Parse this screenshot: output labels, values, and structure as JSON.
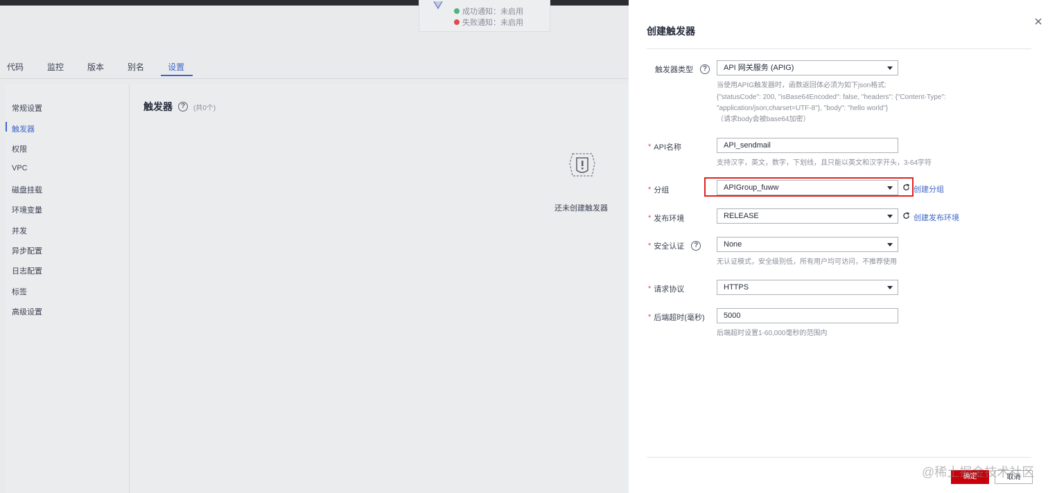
{
  "notifications": {
    "success": "成功通知：未启用",
    "failure": "失败通知：未启用"
  },
  "tabs": [
    "代码",
    "监控",
    "版本",
    "别名",
    "设置"
  ],
  "active_tab": "设置",
  "sidebar": {
    "items": [
      "常规设置",
      "触发器",
      "权限",
      "VPC",
      "磁盘挂载",
      "环境变量",
      "并发",
      "异步配置",
      "日志配置",
      "标签",
      "高级设置"
    ],
    "active": "触发器"
  },
  "main": {
    "title": "触发器",
    "count": "(共0个)",
    "empty_text": "还未创建触发器"
  },
  "drawer": {
    "title": "创建触发器",
    "trigger_type": {
      "label": "触发器类型",
      "value": "API 网关服务 (APIG)",
      "hint": [
        "当使用APIG触发器时，函数返回体必须为如下json格式:",
        "{\"statusCode\": 200, \"isBase64Encoded\": false, \"headers\": {\"Content-Type\":",
        "\"application/json;charset=UTF-8\"}, \"body\": \"hello world\"}",
        "（请求body会被base64加密）"
      ]
    },
    "api_name": {
      "label": "API名称",
      "value": "API_sendmail",
      "hint": "支持汉字，英文，数字，下划线，且只能以英文和汉字开头，3-64字符"
    },
    "group": {
      "label": "分组",
      "value": "APIGroup_fuww",
      "link": "创建分组"
    },
    "environment": {
      "label": "发布环境",
      "value": "RELEASE",
      "link": "创建发布环境"
    },
    "auth": {
      "label": "安全认证",
      "value": "None",
      "hint": "无认证模式，安全级别低，所有用户均可访问，不推荐使用"
    },
    "protocol": {
      "label": "请求协议",
      "value": "HTTPS"
    },
    "timeout": {
      "label": "后端超时(毫秒)",
      "value": "5000",
      "hint": "后端超时设置1-60,000毫秒的范围内"
    },
    "ok_label": "确定",
    "cancel_label": "取消"
  },
  "watermark": "@稀土掘金技术社区",
  "colors": {
    "accent": "#3f66c7",
    "primary_button": "#c7000b",
    "required": "#e04a4a",
    "highlight_box": "#e02020"
  }
}
